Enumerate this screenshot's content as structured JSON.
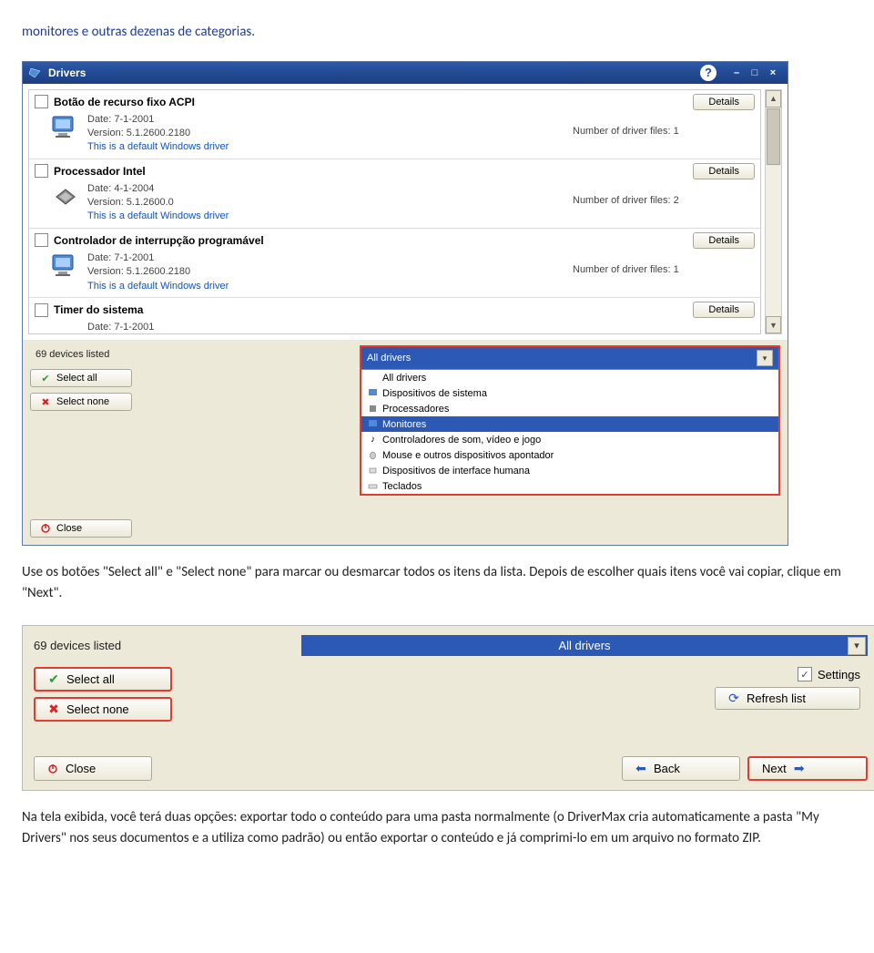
{
  "doc": {
    "intro": "monitores e outras dezenas de categorias.",
    "p1": "Use os botões \"Select all\" e \"Select none\" para marcar ou desmarcar todos os itens da lista. Depois de escolher quais itens você vai copiar, clique em \"Next\".",
    "p2": "Na tela exibida, você terá duas opções: exportar todo o conteúdo para uma pasta normalmente (o DriverMax cria automaticamente a pasta \"My Drivers\" nos seus documentos e a utiliza como padrão) ou então exportar o conteúdo e já comprimi-lo em um arquivo no formato ZIP."
  },
  "window": {
    "title": "Drivers"
  },
  "drivers": [
    {
      "name": "Botão de recurso fixo ACPI",
      "date": "Date: 7-1-2001",
      "version": "Version: 5.1.2600.2180",
      "default": "This is a default Windows driver",
      "files": "Number of driver files: 1",
      "icon": "monitor"
    },
    {
      "name": "Processador Intel",
      "date": "Date: 4-1-2004",
      "version": "Version: 5.1.2600.0",
      "default": "This is a default Windows driver",
      "files": "Number of driver files: 2",
      "icon": "chip"
    },
    {
      "name": "Controlador de interrupção programável",
      "date": "Date: 7-1-2001",
      "version": "Version: 5.1.2600.2180",
      "default": "This is a default Windows driver",
      "files": "Number of driver files: 1",
      "icon": "monitor"
    },
    {
      "name": "Timer do sistema",
      "date": "Date: 7-1-2001",
      "version": "",
      "default": "",
      "files": "",
      "icon": "none"
    }
  ],
  "details_label": "Details",
  "lower": {
    "devices_listed": "69 devices listed",
    "select_all": "Select all",
    "select_none": "Select none",
    "close": "Close"
  },
  "filter": {
    "selected": "All drivers",
    "options": [
      "All drivers",
      "Dispositivos de sistema",
      "Processadores",
      "Monitores",
      "Controladores de som, vídeo e jogo",
      "Mouse e outros dispositivos apontador",
      "Dispositivos de interface humana",
      "Teclados"
    ],
    "highlighted_index": 3
  },
  "panel2": {
    "devices_listed": "69 devices listed",
    "filter_selected": "All drivers",
    "select_all": "Select all",
    "select_none": "Select none",
    "settings": "Settings",
    "refresh": "Refresh list",
    "close": "Close",
    "back": "Back",
    "next": "Next"
  }
}
